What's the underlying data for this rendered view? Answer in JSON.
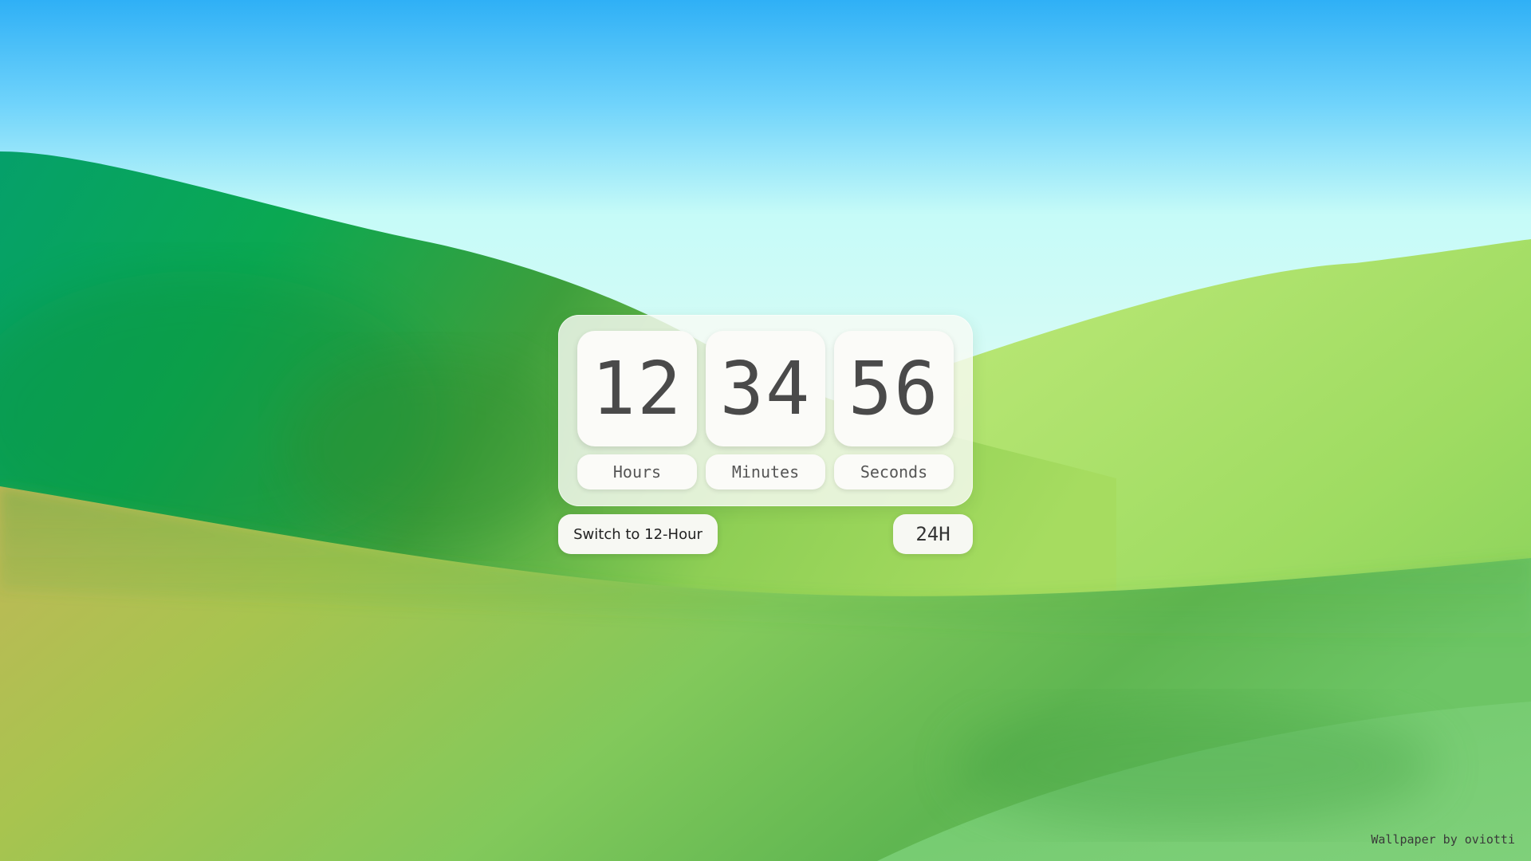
{
  "clock": {
    "hours": "12",
    "minutes": "34",
    "seconds": "56",
    "hours_label": "Hours",
    "minutes_label": "Minutes",
    "seconds_label": "Seconds"
  },
  "controls": {
    "switch_label": "Switch to 12-Hour",
    "mode_label": "24H"
  },
  "footer": {
    "credit": "Wallpaper by oviotti"
  },
  "colors": {
    "sky_top": "#3bb3f5",
    "sky_horizon": "#c9fbf7",
    "hill_dark_green": "#0aa55a",
    "hill_light_green": "#b5e56a",
    "field_green": "#7cc95a",
    "field_yellow": "#c3b85a"
  }
}
